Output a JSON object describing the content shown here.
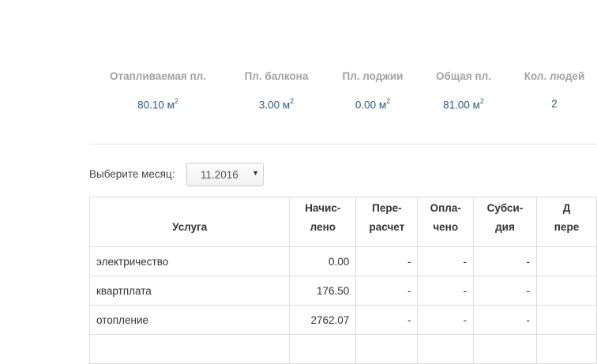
{
  "stats": [
    {
      "label": "Отапливаемая пл.",
      "value": "80.10 м",
      "unit_sup": "2"
    },
    {
      "label": "Пл. балкона",
      "value": "3.00 м",
      "unit_sup": "2"
    },
    {
      "label": "Пл. лоджии",
      "value": "0.00 м",
      "unit_sup": "2"
    },
    {
      "label": "Общая пл.",
      "value": "81.00 м",
      "unit_sup": "2"
    },
    {
      "label": "Кол. людей",
      "value": "2",
      "unit_sup": ""
    }
  ],
  "month_selector": {
    "label": "Выберите месяц:",
    "value": "11.2016"
  },
  "table": {
    "headers": [
      {
        "line1": "",
        "line2": "Услуга"
      },
      {
        "line1": "Начис-",
        "line2": "лено"
      },
      {
        "line1": "Пере-",
        "line2": "расчет"
      },
      {
        "line1": "Опла-",
        "line2": "чено"
      },
      {
        "line1": "Субси-",
        "line2": "дия"
      },
      {
        "line1": "Д",
        "line2": "пере"
      }
    ],
    "rows": [
      {
        "service": "электричество",
        "charged": "0.00",
        "recalc": "-",
        "paid": "-",
        "subsidy": "-"
      },
      {
        "service": "квартплата",
        "charged": "176.50",
        "recalc": "-",
        "paid": "-",
        "subsidy": "-"
      },
      {
        "service": "отопление",
        "charged": "2762.07",
        "recalc": "-",
        "paid": "-",
        "subsidy": "-"
      }
    ]
  }
}
